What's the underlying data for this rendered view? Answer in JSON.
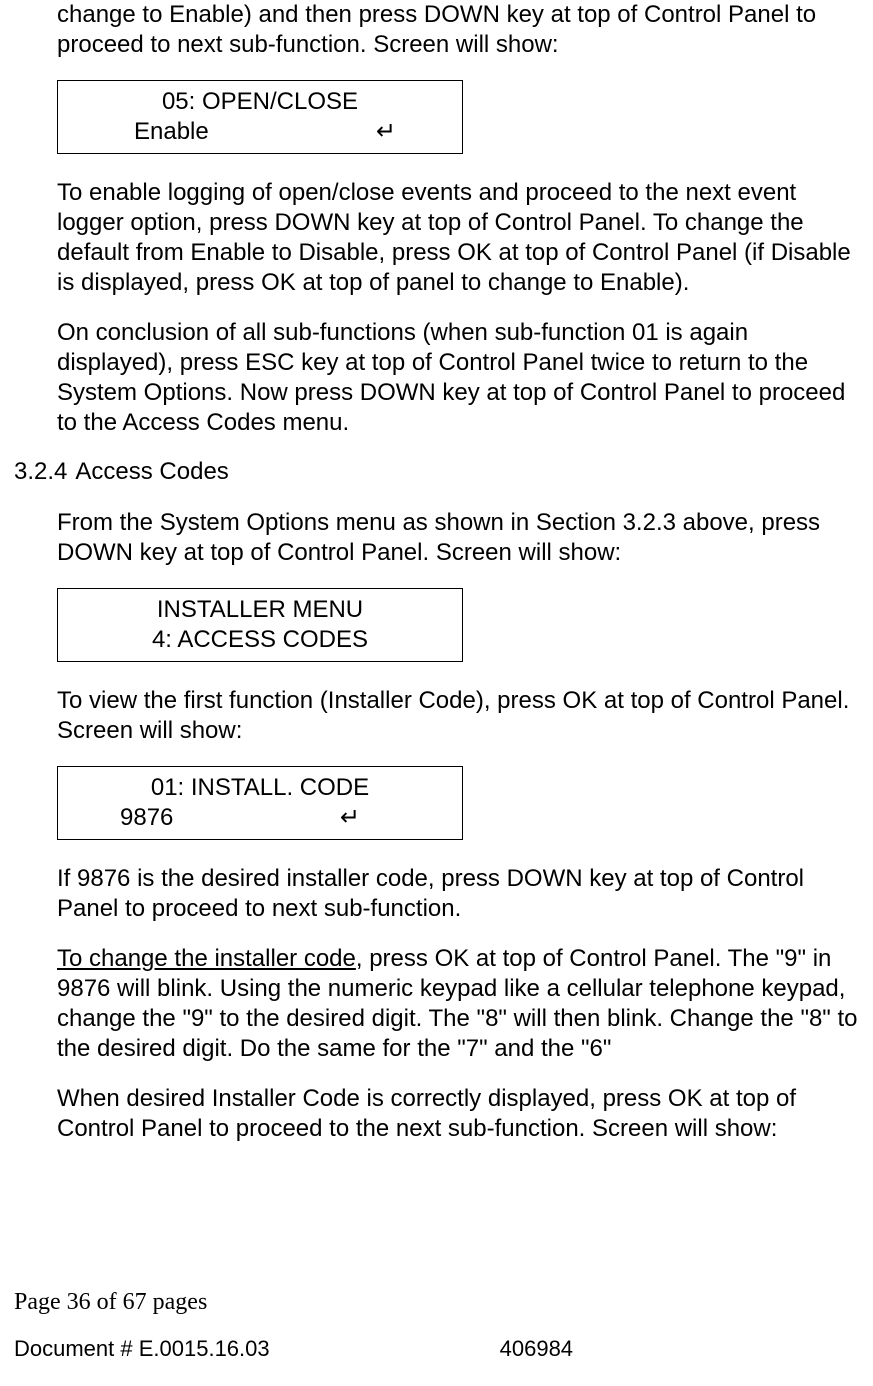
{
  "para1": "change to Enable) and then press DOWN key at top of Control Panel to proceed to next sub-function. Screen will show:",
  "lcd1": {
    "line1": "05: OPEN/CLOSE",
    "left": "Enable",
    "right": "↵"
  },
  "para2": "To enable logging of open/close events and proceed to the next event logger option, press DOWN key at top of Control Panel. To change the default from Enable to Disable, press OK at top of Control Panel (if Disable is displayed, press OK at top of panel to change to Enable).",
  "para3": "On conclusion of all sub-functions (when sub-function 01 is again displayed), press ESC key at top of Control Panel twice to return to the System Options. Now press DOWN key at top of Control Panel to proceed to the Access Codes menu.",
  "section": {
    "num": "3.2.4",
    "title": "Access Codes"
  },
  "para4": "From the System Options menu as shown in Section 3.2.3 above, press DOWN key at top of Control Panel. Screen will show:",
  "lcd2": {
    "line1": "INSTALLER MENU",
    "line2": "4: ACCESS CODES"
  },
  "para5": "To view the first function (Installer Code), press OK at top of Control Panel. Screen will show:",
  "lcd3": {
    "line1": "01: INSTALL. CODE",
    "left": "9876",
    "right": "↵"
  },
  "para6": "If 9876 is the desired installer code, press DOWN key at top of Control Panel to proceed to next sub-function.",
  "para7_underline": "To change the installer code",
  "para7_rest": ", press OK at top of Control Panel. The \"9\" in 9876 will blink. Using the numeric keypad like a cellular telephone keypad, change the \"9\" to the desired digit. The \"8\" will then blink. Change the \"8\" to the desired digit. Do the same for the \"7\" and the \"6\"",
  "para8": "When desired Installer Code is correctly displayed, press OK at top of Control Panel to proceed to the next sub-function. Screen will show:",
  "footer": {
    "page": "Page 36 of  67 pages",
    "doc": "Document # E.0015.16.03",
    "num": "406984"
  }
}
